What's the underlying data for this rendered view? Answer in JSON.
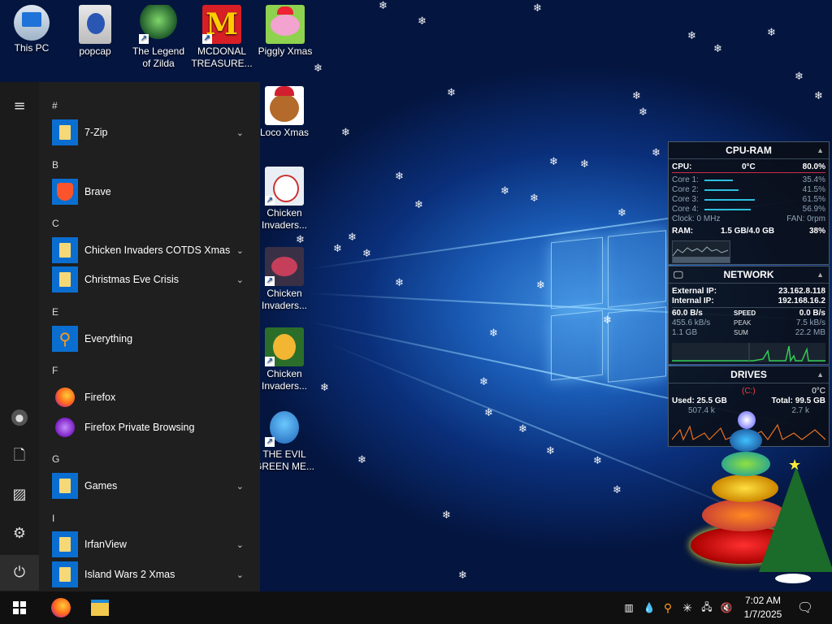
{
  "desktop": {
    "icons": [
      {
        "label": "This PC",
        "icon": "computer-icon"
      },
      {
        "label": "popcap",
        "icon": "folder-icon"
      },
      {
        "label": "The Legend of Zilda",
        "icon": "game-icon"
      },
      {
        "label": "MCDONAL TREASURE...",
        "icon": "mcdonalds-icon"
      },
      {
        "label": "Piggly Xmas",
        "icon": "pig-icon"
      },
      {
        "label": "Loco Xmas",
        "icon": "bear-icon"
      },
      {
        "label": "Chicken Invaders...",
        "icon": "chicken-icon"
      },
      {
        "label": "Chicken Invaders...",
        "icon": "chicken-icon"
      },
      {
        "label": "Chicken Invaders...",
        "icon": "chicken-icon"
      },
      {
        "label": "THE EVIL GREEN ME...",
        "icon": "game-icon"
      }
    ]
  },
  "start_menu": {
    "rail": [
      "hamburger-icon",
      "user-icon",
      "documents-icon",
      "pictures-icon",
      "settings-icon",
      "power-icon"
    ],
    "headers": {
      "hash": "#",
      "b": "B",
      "c": "C",
      "e": "E",
      "f": "F",
      "g": "G",
      "i": "I"
    },
    "items": {
      "zip": "7-Zip",
      "brave": "Brave",
      "chicken": "Chicken Invaders COTDS Xmas",
      "christmas": "Christmas Eve Crisis",
      "everything": "Everything",
      "firefox": "Firefox",
      "firefox_private": "Firefox Private Browsing",
      "games": "Games",
      "irfanview": "IrfanView",
      "island": "Island Wars 2 Xmas"
    }
  },
  "gadgets": {
    "cpu_ram": {
      "title": "CPU-RAM",
      "cpu_label": "CPU:",
      "cpu_temp": "0°C",
      "cpu_pct": "80.0%",
      "cores": [
        {
          "label": "Core 1:",
          "value": "35.4%",
          "frac": 0.354
        },
        {
          "label": "Core 2:",
          "value": "41.5%",
          "frac": 0.415
        },
        {
          "label": "Core 3:",
          "value": "61.5%",
          "frac": 0.615
        },
        {
          "label": "Core 4:",
          "value": "56.9%",
          "frac": 0.569
        }
      ],
      "clock": "Clock: 0 MHz",
      "fan": "FAN: 0rpm",
      "ram_label": "RAM:",
      "ram_value": "1.5 GB/4.0 GB",
      "ram_pct": "38%"
    },
    "network": {
      "title": "NETWORK",
      "external_label": "External IP:",
      "external_ip": "23.162.8.118",
      "internal_label": "Internal IP:",
      "internal_ip": "192.168.16.2",
      "speed_down": "60.0 B/s",
      "speed_label": "SPEED",
      "speed_up": "0.0 B/s",
      "peak_down": "455.6 kB/s",
      "peak_label": "PEAK",
      "peak_up": "7.5 kB/s",
      "sum_down": "1.1 GB",
      "sum_label": "SUM",
      "sum_up": "22.2 MB"
    },
    "drives": {
      "title": "DRIVES",
      "drive": "(C:)",
      "temp": "0°C",
      "used": "Used: 25.5 GB",
      "total": "Total: 99.5 GB",
      "read": "507.4 k",
      "write": "2.7 k"
    }
  },
  "taskbar": {
    "time": "7:02 AM",
    "date": "1/7/2025"
  },
  "colors": {
    "taskbar": "#101010",
    "start_bg": "#1f1f1f",
    "folder_tile": "#0a6ed1",
    "accent_red": "#ff3b3b",
    "graph_green": "#33cc55"
  }
}
